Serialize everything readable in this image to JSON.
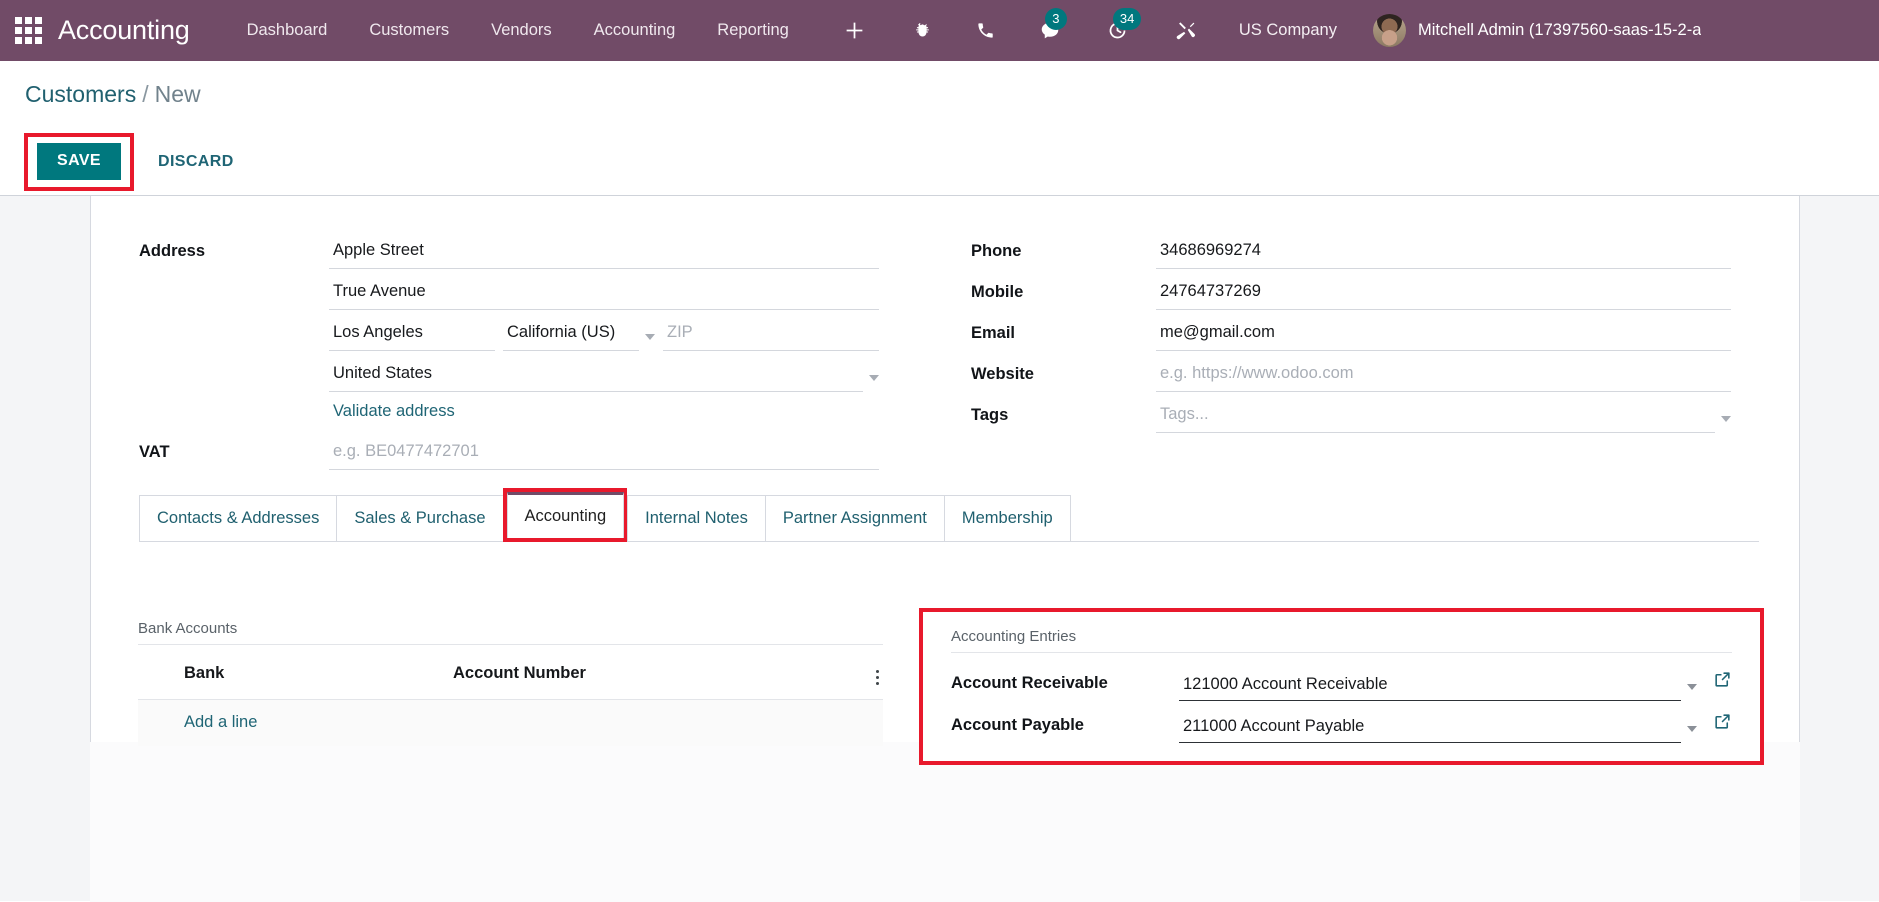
{
  "navbar": {
    "apps_icon": "apps-grid-icon",
    "brand": "Accounting",
    "menu": [
      {
        "label": "Dashboard"
      },
      {
        "label": "Customers"
      },
      {
        "label": "Vendors"
      },
      {
        "label": "Accounting"
      },
      {
        "label": "Reporting"
      }
    ],
    "icons": [
      {
        "name": "plus-icon",
        "badge": ""
      },
      {
        "name": "bug-icon",
        "badge": ""
      },
      {
        "name": "phone-icon",
        "badge": ""
      },
      {
        "name": "chat-icon",
        "badge": "3"
      },
      {
        "name": "activities-clock-icon",
        "badge": "34"
      },
      {
        "name": "tools-icon",
        "badge": ""
      }
    ],
    "chat_badge": "3",
    "activities_badge": "34",
    "company": "US Company",
    "user_name": "Mitchell Admin (17397560-saas-15-2-a",
    "bg_color": "#714B67"
  },
  "control_panel": {
    "breadcrumb_root": "Customers",
    "breadcrumb_sep": "/",
    "breadcrumb_current": "New",
    "save_label": "SAVE",
    "discard_label": "DISCARD",
    "save_color": "#00787E",
    "annotation_color": "#e8192c"
  },
  "form": {
    "left": {
      "address_label": "Address",
      "street": "Apple Street",
      "street2": "True Avenue",
      "city": "Los Angeles",
      "state": "California (US)",
      "zip_placeholder": "ZIP",
      "country": "United States",
      "validate_link": "Validate address",
      "vat_label": "VAT",
      "vat_placeholder": "e.g. BE0477472701"
    },
    "right": {
      "phone_label": "Phone",
      "phone": "34686969274",
      "mobile_label": "Mobile",
      "mobile": "24764737269",
      "email_label": "Email",
      "email": "me@gmail.com",
      "website_label": "Website",
      "website_placeholder": "e.g. https://www.odoo.com",
      "tags_label": "Tags",
      "tags_placeholder": "Tags..."
    }
  },
  "tabs": [
    {
      "label": "Contacts & Addresses",
      "active": false
    },
    {
      "label": "Sales & Purchase",
      "active": false
    },
    {
      "label": "Accounting",
      "active": true
    },
    {
      "label": "Internal Notes",
      "active": false
    },
    {
      "label": "Partner Assignment",
      "active": false
    },
    {
      "label": "Membership",
      "active": false
    }
  ],
  "bank_accounts": {
    "title": "Bank Accounts",
    "columns": [
      "Bank",
      "Account Number"
    ],
    "add_line_label": "Add a line",
    "rows": []
  },
  "accounting_entries": {
    "title": "Accounting Entries",
    "receivable_label": "Account Receivable",
    "receivable_value": "121000 Account Receivable",
    "payable_label": "Account Payable",
    "payable_value": "211000 Account Payable"
  }
}
